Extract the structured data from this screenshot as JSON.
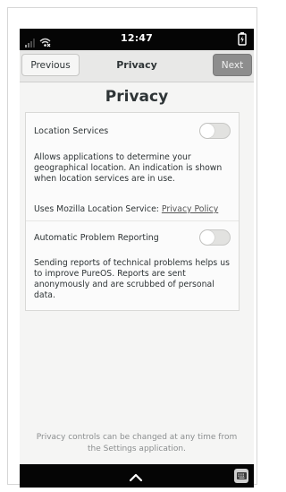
{
  "status": {
    "time": "12:47"
  },
  "header": {
    "previous_label": "Previous",
    "title": "Privacy",
    "next_label": "Next"
  },
  "page": {
    "title": "Privacy"
  },
  "location": {
    "label": "Location Services",
    "enabled": false,
    "description": "Allows applications to determine your geographical location. An indication is shown when location services are in use.",
    "uses_text": "Uses Mozilla Location Service: ",
    "policy_link": "Privacy Policy"
  },
  "reporting": {
    "label": "Automatic Problem Reporting",
    "enabled": false,
    "description": "Sending reports of technical problems helps us to improve PureOS. Reports are sent anonymously and are scrubbed of personal data."
  },
  "footer": {
    "note": "Privacy controls can be changed at any time from the Settings application."
  },
  "colors": {
    "status_bar": "#050505",
    "next_button": "#8d8d8d",
    "text": "#2e3436"
  },
  "icons": {
    "signal": "signal-icon",
    "wifi": "wifi-icon",
    "battery": "battery-charging-icon",
    "nav_up": "chevron-up-icon",
    "keyboard": "keyboard-icon"
  }
}
